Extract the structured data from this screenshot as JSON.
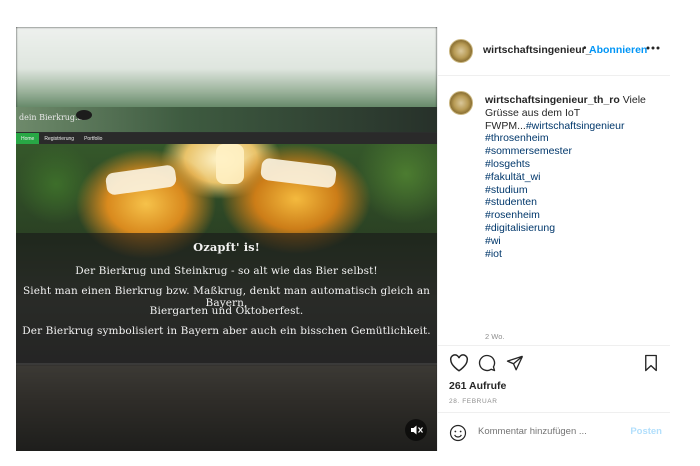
{
  "media": {
    "site_title": "dein Bierkrug.at",
    "nav": [
      "Home",
      "Registrierung",
      "Portfolio"
    ],
    "overlay": {
      "title": "Ozapft' is!",
      "lines": [
        "Der Bierkrug und Steinkrug - so alt wie das Bier selbst!",
        "Sieht man einen Bierkrug bzw. Maßkrug, denkt man automatisch gleich an Bayern,",
        "Biergarten und Oktoberfest.",
        "Der Bierkrug symbolisiert in Bayern aber auch ein bisschen Gemütlichkeit."
      ]
    },
    "mute_icon": "speaker-muted-icon"
  },
  "header": {
    "username": "wirtschaftsingenieur_",
    "separator": "•",
    "follow_label": "Abonnieren",
    "more_icon": "more-horizontal-icon"
  },
  "caption": {
    "username": "wirtschaftsingenieur_th_ro",
    "text": "Viele Grüsse aus dem IoT FWPM...",
    "first_tag": "#wirtschaftsingenieur",
    "hashtags": [
      "#throsenheim",
      "#sommersemester",
      "#losgehts",
      "#fakultät_wi",
      "#studium",
      "#studenten",
      "#rosenheim",
      "#digitalisierung",
      "#wi",
      "#iot"
    ],
    "time_ago": "2 Wo."
  },
  "actions": {
    "like_icon": "heart-icon",
    "comment_icon": "comment-icon",
    "share_icon": "send-icon",
    "save_icon": "bookmark-icon",
    "views": "261 Aufrufe",
    "date": "28. FEBRUAR"
  },
  "comment": {
    "emoji_icon": "emoji-icon",
    "placeholder": "Kommentar hinzufügen ...",
    "post_label": "Posten"
  },
  "colors": {
    "link_blue": "#0095f6",
    "hashtag": "#00376b",
    "muted_text": "#8e8e8e",
    "post_disabled": "#b2dffc"
  }
}
